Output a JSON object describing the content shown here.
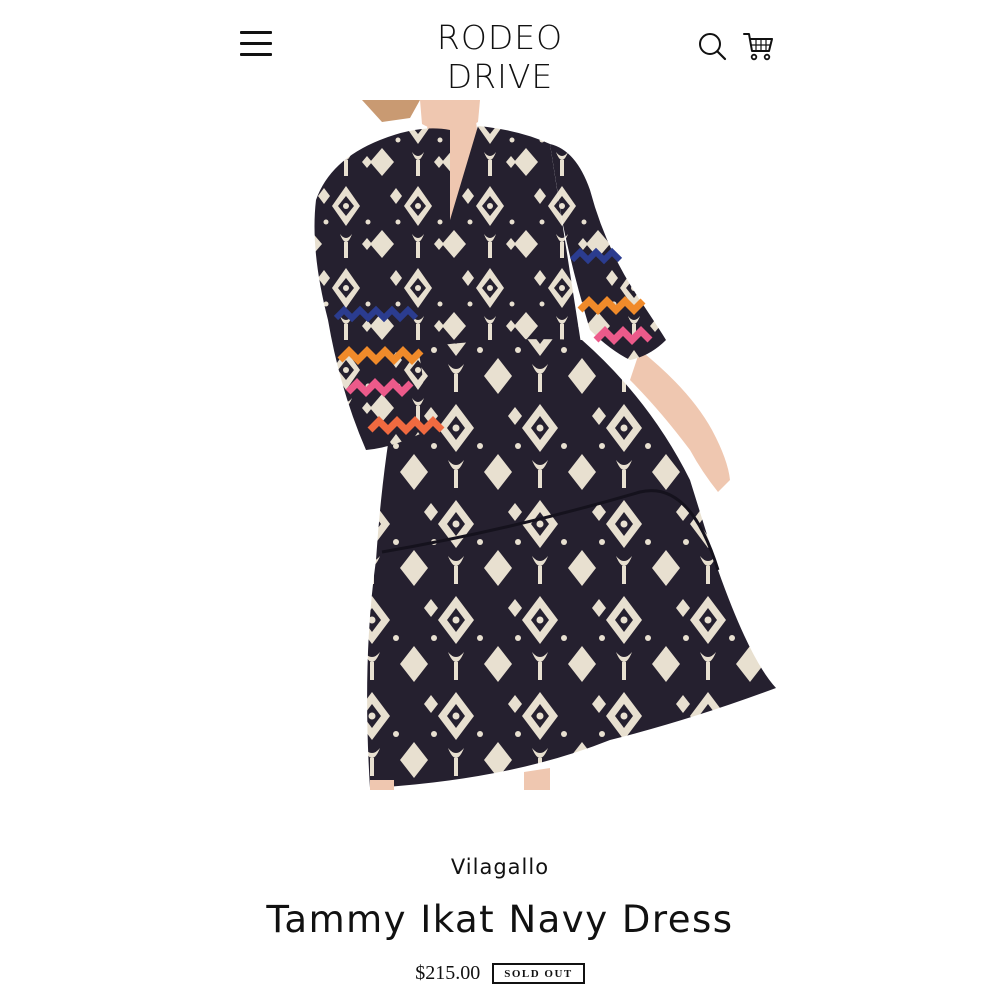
{
  "header": {
    "logo_text": "RODEO DRIVE",
    "menu_icon": "hamburger-menu-icon",
    "search_icon": "search-icon",
    "cart_icon": "shopping-cart-icon"
  },
  "product": {
    "image_alt": "Model wearing navy and cream ikat print tiered dress with colorful ric-rac trimmed sleeves",
    "vendor": "Vilagallo",
    "title": "Tammy Ikat Navy Dress",
    "price": "$215.00",
    "badge": "SOLD OUT"
  },
  "colors": {
    "text": "#111111",
    "background": "#ffffff",
    "dress_navy": "#25202f",
    "dress_cream": "#e8e0d0",
    "trim_orange": "#f08a2a",
    "trim_pink": "#ec5a8a",
    "trim_navy_blue": "#2b3c8f",
    "skin": "#efc7b0"
  }
}
